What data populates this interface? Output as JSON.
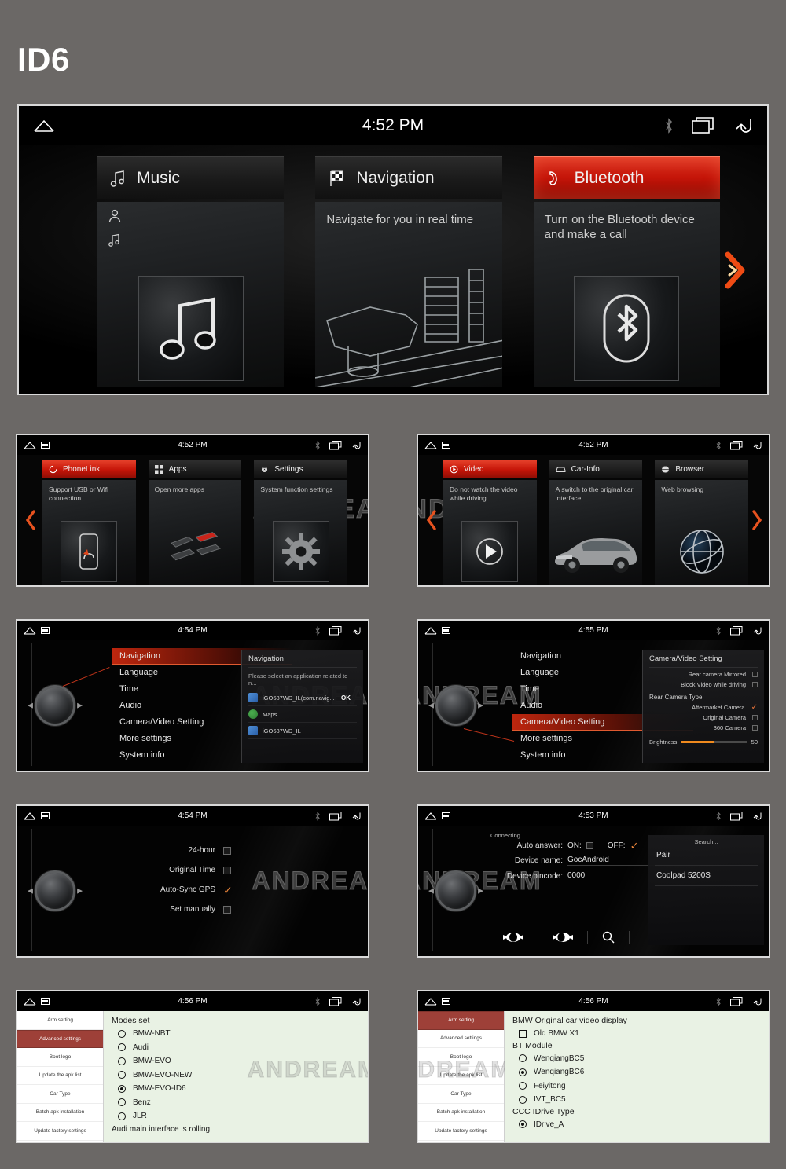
{
  "page": {
    "title": "ID6",
    "watermark": "ANDREAM"
  },
  "hero": {
    "statusbar": {
      "time": "4:52 PM",
      "home_icon": "home-icon",
      "bluetooth_icon": "bluetooth-icon",
      "recents_icon": "recent-apps-icon",
      "back_icon": "back-icon"
    },
    "tiles": [
      {
        "label": "Music",
        "icon": "music-note-icon",
        "desc": "",
        "active": false,
        "glyph": "music-note-icon"
      },
      {
        "label": "Navigation",
        "icon": "checkered-flag-icon",
        "desc": "Navigate for you in real time",
        "active": false,
        "glyph": "navigation-scene-icon"
      },
      {
        "label": "Bluetooth",
        "icon": "phone-handset-icon",
        "desc": "Turn on the Bluetooth device and make a call",
        "active": true,
        "glyph": "bluetooth-icon"
      }
    ],
    "next_arrow": "chevron-right-icon"
  },
  "screen_phonelink": {
    "statusbar": {
      "time": "4:52 PM"
    },
    "prev_arrow": "chevron-left-icon",
    "tiles": [
      {
        "label": "PhoneLink",
        "icon": "circle-arrow-icon",
        "desc": "Support USB or Wifi connection",
        "active": true,
        "glyph": "phone-mirror-icon"
      },
      {
        "label": "Apps",
        "icon": "grid-icon",
        "desc": "Open more apps",
        "active": false,
        "glyph": "windows-tiles-icon"
      },
      {
        "label": "Settings",
        "icon": "gear-icon",
        "desc": "System function settings",
        "active": false,
        "glyph": "gear-icon"
      }
    ]
  },
  "screen_video": {
    "statusbar": {
      "time": "4:52 PM"
    },
    "prev_arrow": "chevron-left-icon",
    "next_arrow": "chevron-right-icon",
    "tiles": [
      {
        "label": "Video",
        "icon": "play-circle-icon",
        "desc": "Do not watch the video while driving",
        "active": true,
        "glyph": "play-icon"
      },
      {
        "label": "Car-Info",
        "icon": "car-icon",
        "desc": "A switch to the original car interface",
        "active": false,
        "glyph": "car-icon"
      },
      {
        "label": "Browser",
        "icon": "globe-icon",
        "desc": "Web browsing",
        "active": false,
        "glyph": "globe-icon"
      }
    ]
  },
  "screen_settings_nav": {
    "statusbar": {
      "time": "4:54 PM"
    },
    "menu": [
      "Navigation",
      "Language",
      "Time",
      "Audio",
      "Camera/Video Setting",
      "More settings",
      "System info"
    ],
    "selected": "Navigation",
    "panel": {
      "title": "Navigation",
      "prompt": "Please select an application related to n...",
      "ok_label": "OK",
      "apps": [
        {
          "name": "iGO687WD_IL(com.navig...",
          "icon": "igo-app-icon"
        },
        {
          "name": "Maps",
          "icon": "maps-app-icon"
        },
        {
          "name": "iGO687WD_IL",
          "icon": "igo-app-icon"
        }
      ]
    }
  },
  "screen_settings_camera": {
    "statusbar": {
      "time": "4:55 PM"
    },
    "menu": [
      "Navigation",
      "Language",
      "Time",
      "Audio",
      "Camera/Video Setting",
      "More settings",
      "System info"
    ],
    "selected": "Camera/Video Setting",
    "panel": {
      "title": "Camera/Video Setting",
      "checks": [
        {
          "label": "Rear camera Mirrored",
          "checked": false
        },
        {
          "label": "Block Video while driving",
          "checked": false
        }
      ],
      "group_label": "Rear Camera Type",
      "types": [
        {
          "label": "Aftermarket Camera",
          "checked": true
        },
        {
          "label": "Original Camera",
          "checked": false
        },
        {
          "label": "360 Camera",
          "checked": false
        }
      ],
      "brightness_label": "Brightness",
      "brightness_value": "50"
    }
  },
  "screen_time": {
    "statusbar": {
      "time": "4:54 PM"
    },
    "rows": [
      {
        "label": "24-hour",
        "checked": false
      },
      {
        "label": "Original Time",
        "checked": false
      },
      {
        "label": "Auto-Sync GPS",
        "checked": true
      },
      {
        "label": "Set manually",
        "checked": false
      }
    ]
  },
  "screen_bluetooth": {
    "statusbar": {
      "time": "4:53 PM"
    },
    "connecting": "Connecting...",
    "auto_answer_label": "Auto answer:",
    "on_label": "ON:",
    "off_label": "OFF:",
    "on_checked": false,
    "off_checked": true,
    "device_name_label": "Device name:",
    "device_name_value": "GocAndroid",
    "pincode_label": "Device pincode:",
    "pincode_value": "0000",
    "dock_icons": [
      "call-answer-icon",
      "call-end-icon",
      "search-icon"
    ],
    "panel": {
      "search": "Search...",
      "pair_label": "Pair",
      "devices": [
        "Coolpad 5200S"
      ]
    }
  },
  "screen_factory_advanced": {
    "statusbar": {
      "time": "4:56 PM"
    },
    "sidebar": [
      "Arm setting",
      "Advanced settings",
      "Boot logo",
      "Update the apk list",
      "Car Type",
      "Batch apk installation",
      "Update factory settings"
    ],
    "sidebar_active": "Advanced settings",
    "heading": "Modes set",
    "modes": [
      {
        "label": "BMW-NBT",
        "selected": false
      },
      {
        "label": "Audi",
        "selected": false
      },
      {
        "label": "BMW-EVO",
        "selected": false
      },
      {
        "label": "BMW-EVO-NEW",
        "selected": false
      },
      {
        "label": "BMW-EVO-ID6",
        "selected": true
      },
      {
        "label": "Benz",
        "selected": false
      },
      {
        "label": "JLR",
        "selected": false
      }
    ],
    "note": "Audi main interface is rolling"
  },
  "screen_factory_arm": {
    "statusbar": {
      "time": "4:56 PM"
    },
    "sidebar": [
      "Arm setting",
      "Advanced settings",
      "Boot logo",
      "Update the apk list",
      "Car Type",
      "Batch apk installation",
      "Update factory settings"
    ],
    "sidebar_active": "Arm setting",
    "heading1": "BMW Original car video display",
    "checkbox1": {
      "label": "Old BMW X1",
      "checked": false
    },
    "heading2": "BT Module",
    "bt_modules": [
      {
        "label": "WenqiangBC5",
        "selected": false
      },
      {
        "label": "WenqiangBC6",
        "selected": true
      },
      {
        "label": "Feiyitong",
        "selected": false
      },
      {
        "label": "IVT_BC5",
        "selected": false
      }
    ],
    "heading3": "CCC IDrive Type",
    "idrive": [
      {
        "label": "IDrive_A",
        "selected": true
      }
    ]
  }
}
